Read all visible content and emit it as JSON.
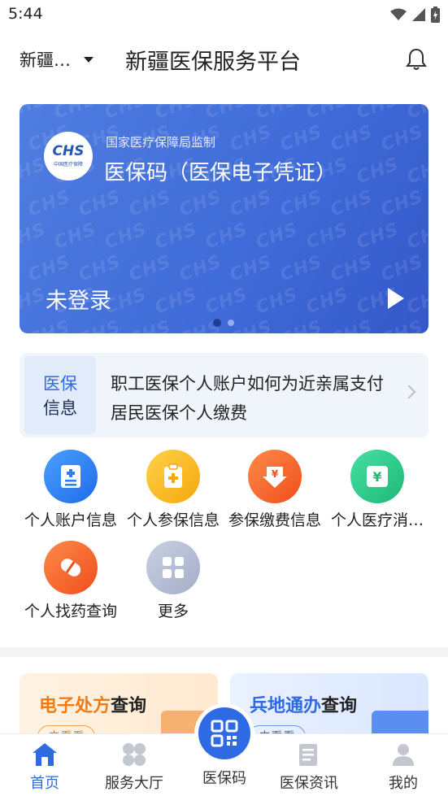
{
  "status_bar": {
    "time": "5:44"
  },
  "header": {
    "region": "新疆…",
    "title": "新疆医保服务平台"
  },
  "banner": {
    "logo_text": "CHS",
    "logo_sub": "中国医疗保障",
    "supervisor": "国家医疗保障局监制",
    "title": "医保码（医保电子凭证）",
    "login_status": "未登录",
    "watermark": "CHS"
  },
  "info_card": {
    "tag_line1": "医保",
    "tag_line2": "信息",
    "text": "职工医保个人账户如何为近亲属支付居民医保个人缴费"
  },
  "services": [
    {
      "label": "个人账户信息",
      "icon": "account-icon",
      "color": "#2f7ef0"
    },
    {
      "label": "个人参保信息",
      "icon": "insurance-icon",
      "color": "#f6b51e"
    },
    {
      "label": "参保缴费信息",
      "icon": "payment-icon",
      "color": "#f2682e"
    },
    {
      "label": "个人医疗消…",
      "icon": "consumption-icon",
      "color": "#2cc58a"
    },
    {
      "label": "个人找药查询",
      "icon": "medicine-icon",
      "color": "#f2682e"
    },
    {
      "label": "更多",
      "icon": "more-icon",
      "color": "#b8c0d6"
    }
  ],
  "promos": [
    {
      "highlight": "电子处方",
      "rest": "查询",
      "button": "去看看"
    },
    {
      "highlight": "兵地通办",
      "rest": "查询",
      "button": "去看看"
    }
  ],
  "tabbar": {
    "home": "首页",
    "services": "服务大厅",
    "code": "医保码",
    "news": "医保资讯",
    "mine": "我的"
  }
}
